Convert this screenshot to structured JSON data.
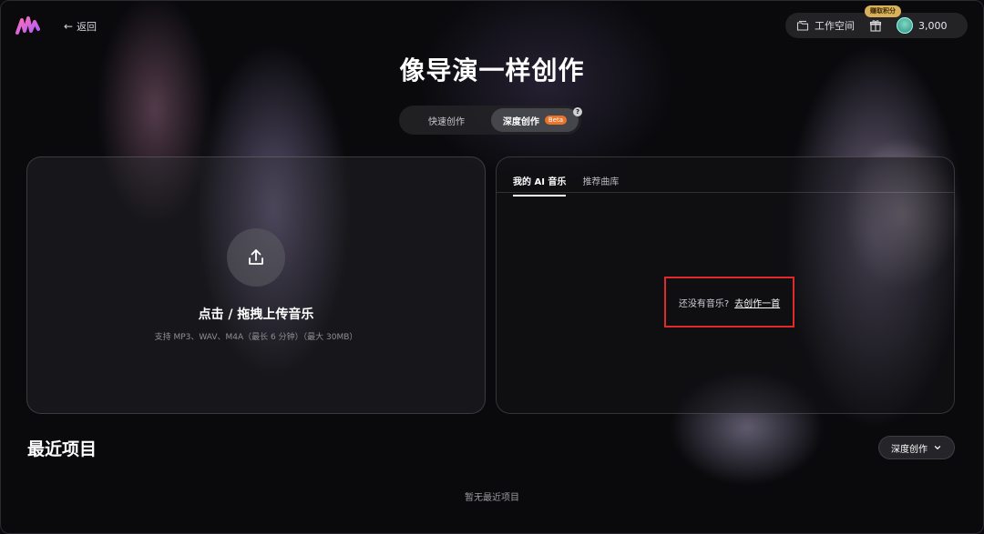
{
  "header": {
    "back_label": "返回",
    "workspace_label": "工作空间",
    "earn_badge": "赚取积分",
    "credits": "3,000"
  },
  "page": {
    "title": "像导演一样创作"
  },
  "mode_switch": {
    "tabs": [
      "快速创作",
      "深度创作"
    ],
    "active_index": 1,
    "beta_badge": "Beta",
    "help": "?"
  },
  "upload": {
    "title": "点击 / 拖拽上传音乐",
    "subtitle": "支持 MP3、WAV、M4A（最长 6 分钟）（最大 30MB）"
  },
  "music_panel": {
    "tabs": [
      "我的 AI 音乐",
      "推荐曲库"
    ],
    "active_index": 0,
    "empty_text": "还没有音乐?",
    "create_link": "去创作一首"
  },
  "recent": {
    "title": "最近项目",
    "filter_label": "深度创作",
    "empty_text": "暂无最近项目"
  },
  "colors": {
    "accent_highlight": "#e0292b",
    "beta": "#e8752a",
    "earn_badge": "#d8b15a"
  }
}
